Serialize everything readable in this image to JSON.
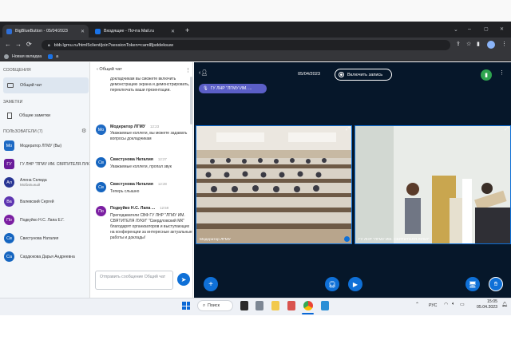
{
  "browser": {
    "tabs": [
      {
        "title": "BigBlueButton - 05/04/2023",
        "active": true
      },
      {
        "title": "Входящие - Почта Mail.ru",
        "active": false
      }
    ],
    "new_tab": "+",
    "url": "bbb.lgmu.ru/html5client/join?sessionToken=caml8jsddeksuw",
    "bookmarks": [
      {
        "label": "Новая вкладка"
      },
      {
        "label": "a"
      }
    ]
  },
  "sidebar": {
    "messages_title": "СООБЩЕНИЯ",
    "public_chat": "Общий чат",
    "notes_title": "ЗАМЕТКИ",
    "shared_notes": "Общие заметки",
    "users_title": "ПОЛЬЗОВАТЕЛИ (7)",
    "users": [
      {
        "initials": "Мо",
        "name": "Модератор ЛГМУ (Вы)",
        "sub": "",
        "color": "#1e6ac4",
        "square": true
      },
      {
        "initials": "ГУ",
        "name": "ГУ ЛНР \"ЛГМУ ИМ. СВЯТИТЕЛЯ ЛУКИ\"",
        "sub": "",
        "color": "#6a1b9a",
        "square": true
      },
      {
        "initials": "Ал",
        "name": "Алена Селида",
        "sub": "Мобильный",
        "color": "#283593",
        "square": false
      },
      {
        "initials": "Ва",
        "name": "Валевский Сергей",
        "sub": "",
        "color": "#5e35b1",
        "square": false
      },
      {
        "initials": "По",
        "name": "Подкуйко Н.С. Лапа Е.Г.",
        "sub": "",
        "color": "#7b1fa2",
        "square": false
      },
      {
        "initials": "Св",
        "name": "Свистунова Наталия",
        "sub": "",
        "color": "#1565c0",
        "square": false
      },
      {
        "initials": "Са",
        "name": "Сардюкова Дарья Андреевна",
        "sub": "",
        "color": "#1565c0",
        "square": false
      }
    ]
  },
  "chat": {
    "header": "Общий чат",
    "messages": [
      {
        "initials": "",
        "name": "",
        "time": "",
        "text": "докладчикам вы сможете включить демонстрацию экрана и демонстрировать, переключать ваши презентации.",
        "color": ""
      },
      {
        "initials": "Мо",
        "name": "Модератор ЛГМУ",
        "time": "12:23",
        "text": "Уважаемые коллеги, вы можете задавать вопросы докладчикам",
        "color": "#1e6ac4"
      },
      {
        "initials": "Св",
        "name": "Свистунова Наталия",
        "time": "12:27",
        "text": "Уважаемые коллеги, пропал звук",
        "color": "#1565c0"
      },
      {
        "initials": "Св",
        "name": "Свистунова Наталия",
        "time": "12:28",
        "text": "Теперь слышно",
        "color": "#1565c0"
      },
      {
        "initials": "По",
        "name": "Подкуйко Н.С. Лапа ...",
        "time": "12:59",
        "text": "Преподаватели СВФ ГУ ЛНР \"ЛГМУ ИМ. СВЯТИТЕЛЯ ЛУКИ\" \"Свердловский МК\" благодарят организаторов и выступающих на конференции за интересные актуальные работы и доклады!",
        "color": "#7b1fa2"
      }
    ],
    "input_placeholder": "Отправить сообщение Общий чат"
  },
  "meeting": {
    "date": "05/04/2023",
    "record_label": "Включить запись",
    "presenter_chip": "ГУ ЛНР \"ЛГМУ ИМ. ...",
    "videos": [
      {
        "label": "Модератор ЛГМУ"
      },
      {
        "label": "ГУ ЛНР \"ЛГМУ ИМ. СВЯТИТЕЛЯ ЛУКИ\""
      }
    ]
  },
  "taskbar": {
    "search_label": "Поиск",
    "lang": "РУС",
    "time": "15:05",
    "date": "05.04.2023"
  }
}
